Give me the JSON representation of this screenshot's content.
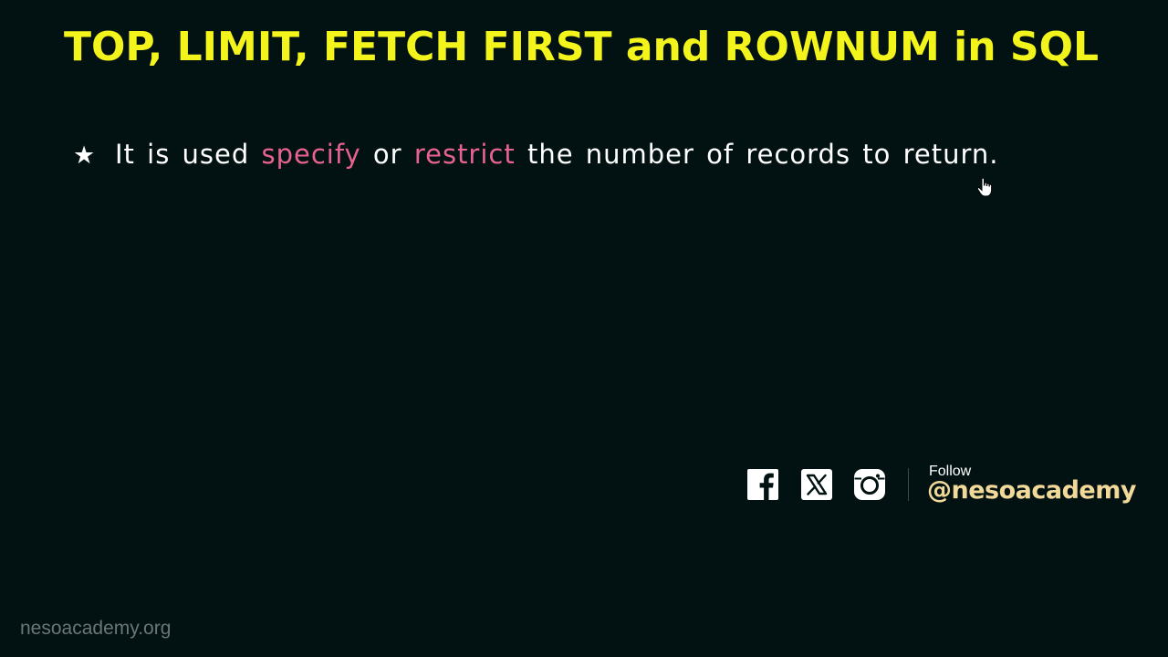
{
  "slide": {
    "title": "TOP, LIMIT, FETCH FIRST and ROWNUM in SQL",
    "bullet": {
      "icon": "star-icon",
      "part1": "It is used ",
      "highlight1": "specify",
      "part2": " or ",
      "highlight2": "restrict",
      "part3": " the number of records to return."
    }
  },
  "social": {
    "icons": [
      "facebook-icon",
      "x-icon",
      "instagram-icon"
    ],
    "follow_label": "Follow",
    "handle": "@nesoacademy"
  },
  "footer": {
    "watermark": "nesoacademy.org"
  },
  "colors": {
    "background": "#021212",
    "title": "#f4f41d",
    "highlight": "#e8628f",
    "handle": "#f2d99a"
  }
}
